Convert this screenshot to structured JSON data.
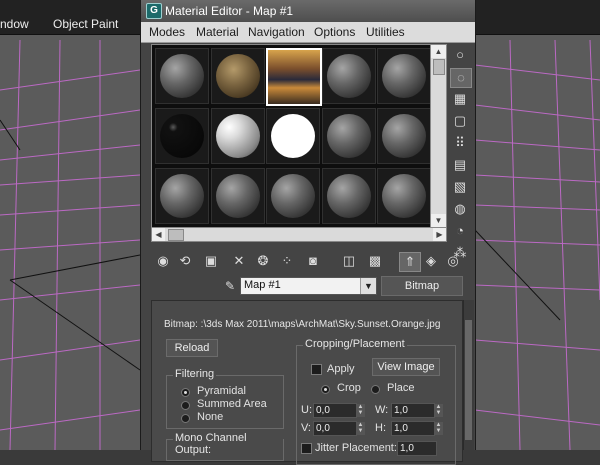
{
  "background": {
    "menu_labels": [
      "ndow",
      "Object Paint"
    ],
    "grid_color": "#c66bd0",
    "viewport_color": "#5b5b5b"
  },
  "window": {
    "title": "Material Editor - Map #1",
    "icon_label": "G"
  },
  "menu": [
    "Modes",
    "Material",
    "Navigation",
    "Options",
    "Utilities"
  ],
  "slots": {
    "rows": 3,
    "cols": 5,
    "active_index": 2,
    "colors": {
      "frame": "#888888",
      "active_border": "#ffffff"
    },
    "special": {
      "1": "rock",
      "2": "sunset",
      "5": "black",
      "6": "white-glossy",
      "7": "pure-white"
    }
  },
  "side_tools": [
    "sphere-icon",
    "cylinder-icon",
    "checker-icon",
    "cube-icon",
    "dotted-icon",
    "list-icon",
    "film-icon",
    "options-icon",
    "search-icon",
    "sphere-grid-icon"
  ],
  "toolbar": [
    "get-material-icon",
    "put-material-icon",
    "assign-icon",
    "delete-icon",
    "copy-icon",
    "unique-icon",
    "put-library-icon",
    "id-channel-icon",
    "show-map-icon",
    "show-background-icon",
    "go-parent-icon",
    "go-forward-icon",
    "sibling-icon"
  ],
  "name_row": {
    "map_name": "Map #1",
    "type_button": "Bitmap"
  },
  "rollout": {
    "bitmap_path": "Bitmap: :\\3ds Max 2011\\maps\\ArchMat\\Sky.Sunset.Orange.jpg",
    "reload": "Reload",
    "filtering": {
      "title": "Filtering",
      "options": [
        "Pyramidal",
        "Summed Area",
        "None"
      ],
      "selected": 0
    },
    "mono_title": "Mono Channel Output:",
    "cropping": {
      "title": "Cropping/Placement",
      "apply": "Apply",
      "view_image": "View Image",
      "crop": "Crop",
      "place": "Place",
      "u_label": "U:",
      "u_value": "0,0",
      "v_label": "V:",
      "v_value": "0,0",
      "w_label": "W:",
      "w_value": "1,0",
      "h_label": "H:",
      "h_value": "1,0",
      "jitter": "Jitter Placement:",
      "jitter_value": "1,0"
    }
  }
}
